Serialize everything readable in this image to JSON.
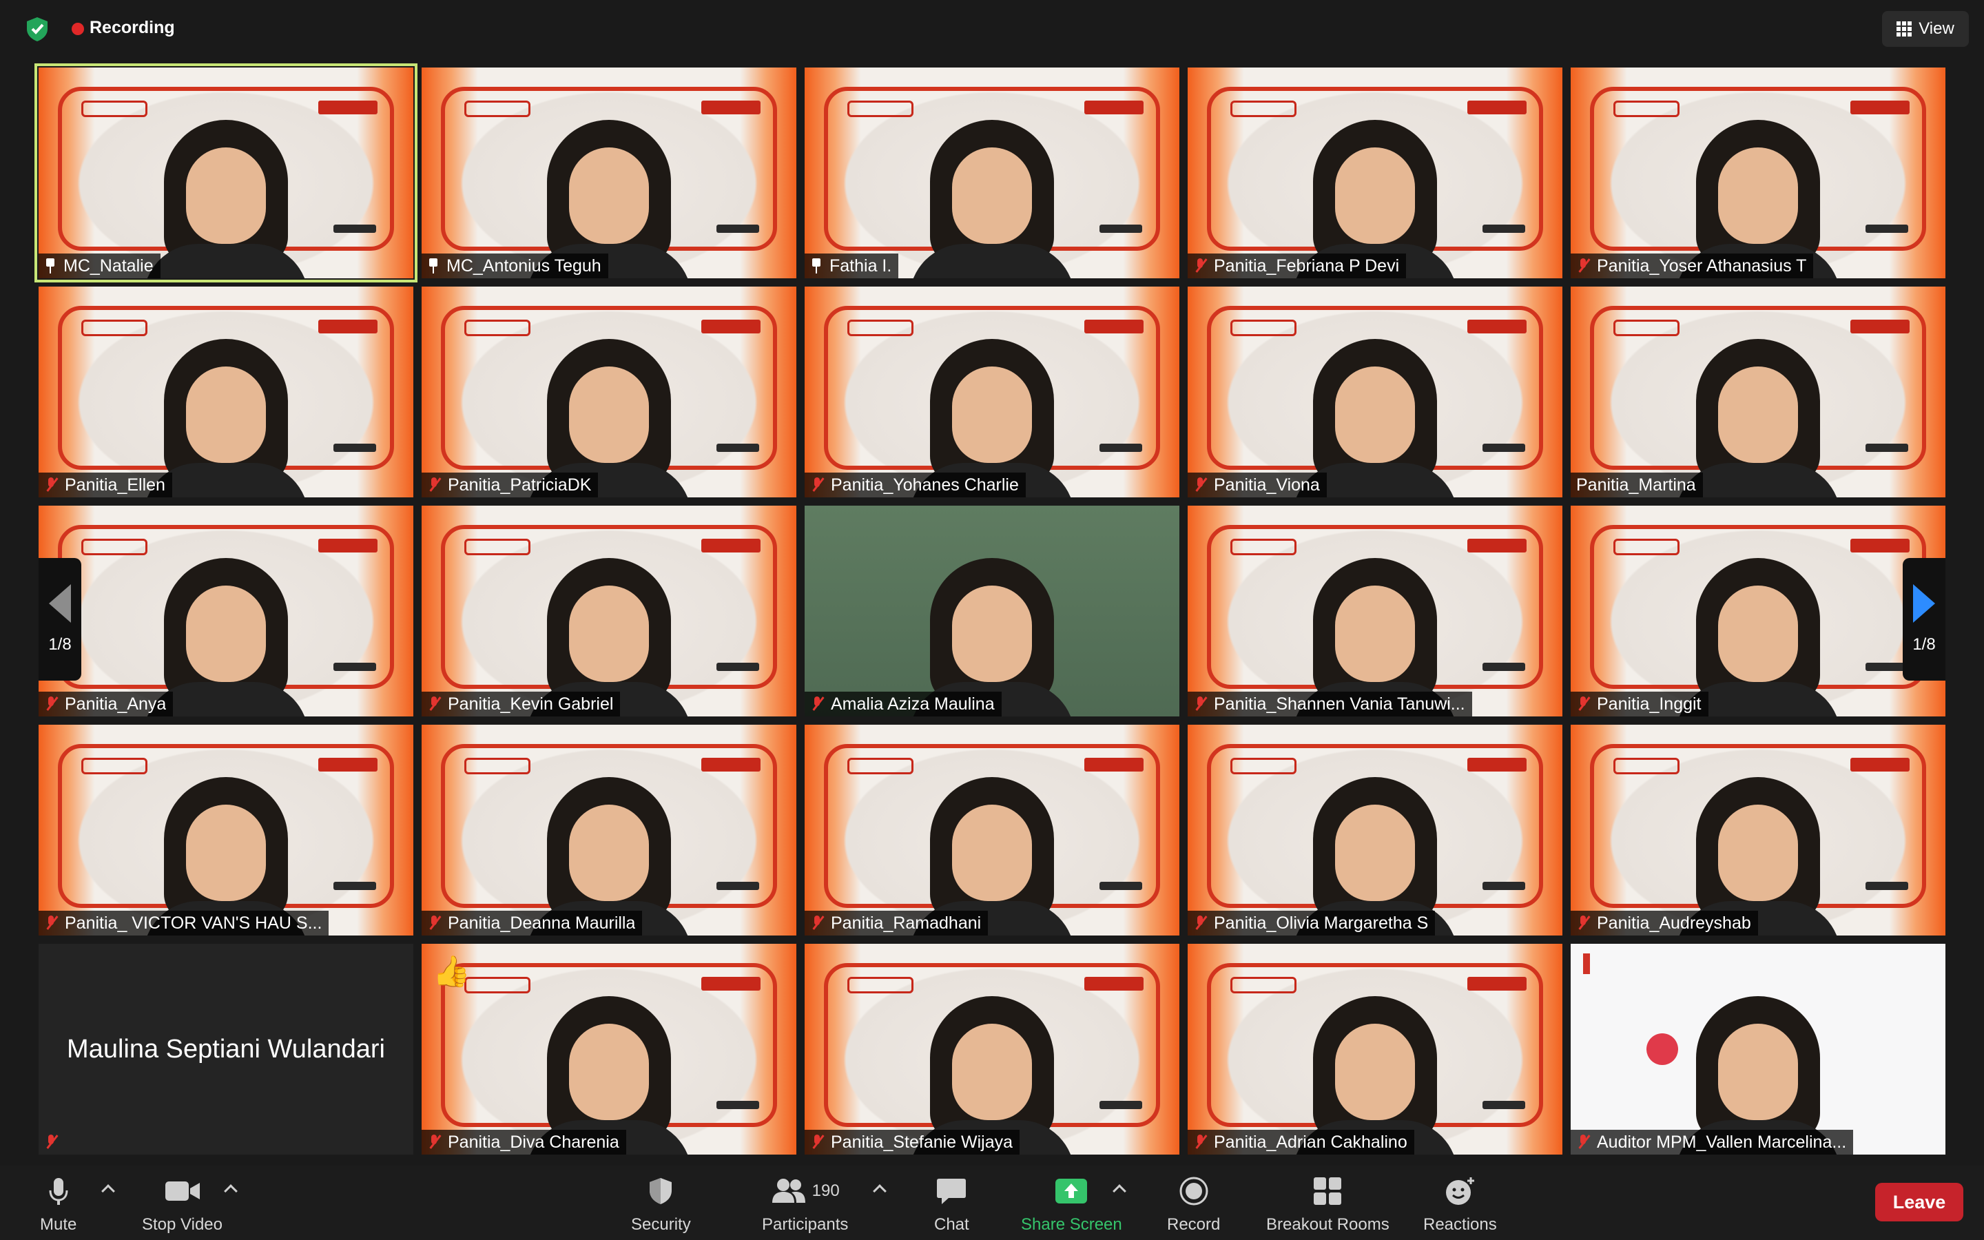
{
  "topbar": {
    "recording_label": "Recording",
    "view_label": "View"
  },
  "pager": {
    "page": "1/8"
  },
  "participants": [
    {
      "name": "MC_Natalie",
      "status": "pinned",
      "tile": "video",
      "active": true
    },
    {
      "name": "MC_Antonius Teguh",
      "status": "pinned",
      "tile": "video"
    },
    {
      "name": "Fathia I.",
      "status": "pinned",
      "tile": "video"
    },
    {
      "name": "Panitia_Febriana P Devi",
      "status": "muted",
      "tile": "video"
    },
    {
      "name": "Panitia_Yoser Athanasius T",
      "status": "muted",
      "tile": "video"
    },
    {
      "name": "Panitia_Ellen",
      "status": "muted",
      "tile": "video"
    },
    {
      "name": "Panitia_PatriciaDK",
      "status": "muted",
      "tile": "video"
    },
    {
      "name": "Panitia_Yohanes Charlie",
      "status": "muted",
      "tile": "video"
    },
    {
      "name": "Panitia_Viona",
      "status": "muted",
      "tile": "video"
    },
    {
      "name": "Panitia_Martina",
      "status": "none",
      "tile": "video"
    },
    {
      "name": "Panitia_Anya",
      "status": "muted",
      "tile": "video"
    },
    {
      "name": "Panitia_Kevin Gabriel",
      "status": "muted",
      "tile": "video"
    },
    {
      "name": "Amalia Aziza Maulina",
      "status": "muted",
      "tile": "green"
    },
    {
      "name": "Panitia_Shannen Vania Tanuwi...",
      "status": "muted",
      "tile": "video"
    },
    {
      "name": "Panitia_Inggit",
      "status": "muted",
      "tile": "video"
    },
    {
      "name": "Panitia_ VICTOR VAN'S HAU S...",
      "status": "muted",
      "tile": "video"
    },
    {
      "name": "Panitia_Deanna Maurilla",
      "status": "muted",
      "tile": "video"
    },
    {
      "name": "Panitia_Ramadhani",
      "status": "muted",
      "tile": "video"
    },
    {
      "name": "Panitia_Olivia Margaretha S",
      "status": "muted",
      "tile": "video"
    },
    {
      "name": "Panitia_Audreyshab",
      "status": "muted",
      "tile": "video"
    },
    {
      "name": "Maulina Septiani Wulandari",
      "status": "muted",
      "tile": "blank"
    },
    {
      "name": "Panitia_Diva Charenia",
      "status": "muted",
      "tile": "video",
      "reaction": "👍"
    },
    {
      "name": "Panitia_Stefanie Wijaya",
      "status": "muted",
      "tile": "video"
    },
    {
      "name": "Panitia_Adrian Cakhalino",
      "status": "muted",
      "tile": "video"
    },
    {
      "name": "Auditor MPM_Vallen Marcelina...",
      "status": "muted",
      "tile": "white"
    }
  ],
  "toolbar": {
    "mute": "Mute",
    "stop_video": "Stop Video",
    "security": "Security",
    "participants": "Participants",
    "participants_count": "190",
    "chat": "Chat",
    "share_screen": "Share Screen",
    "record": "Record",
    "breakout_rooms": "Breakout Rooms",
    "reactions": "Reactions",
    "leave": "Leave"
  },
  "colors": {
    "accent_green": "#35c46b",
    "leave_red": "#c6232b",
    "recording_red": "#e02828",
    "active_speaker": "#c8e676",
    "pager_blue": "#2d8cff"
  }
}
